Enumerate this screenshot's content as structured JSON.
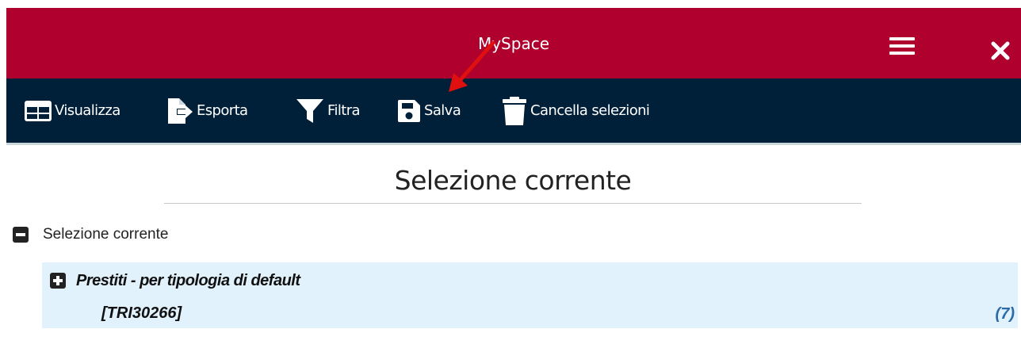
{
  "app": {
    "title": "MySpace"
  },
  "toolbar": {
    "items": [
      {
        "label": "Visualizza",
        "icon": "table-icon"
      },
      {
        "label": "Esporta",
        "icon": "export-icon"
      },
      {
        "label": "Filtra",
        "icon": "filter-icon"
      },
      {
        "label": "Salva",
        "icon": "save-icon"
      },
      {
        "label": "Cancella selezioni",
        "icon": "trash-icon"
      }
    ]
  },
  "main": {
    "heading": "Selezione corrente",
    "tree": {
      "root": {
        "label": "Selezione corrente",
        "state": "expanded"
      },
      "children": [
        {
          "name": "Prestiti - per tipologia di default",
          "code": "[TRI30266]",
          "count": "(7)",
          "state": "collapsed"
        }
      ]
    }
  },
  "colors": {
    "titlebar": "#b0002d",
    "toolbar": "#001f38",
    "row_highlight": "#e1f2fd",
    "count_text": "#2b6aa8",
    "annotation_arrow": "#e01010"
  }
}
